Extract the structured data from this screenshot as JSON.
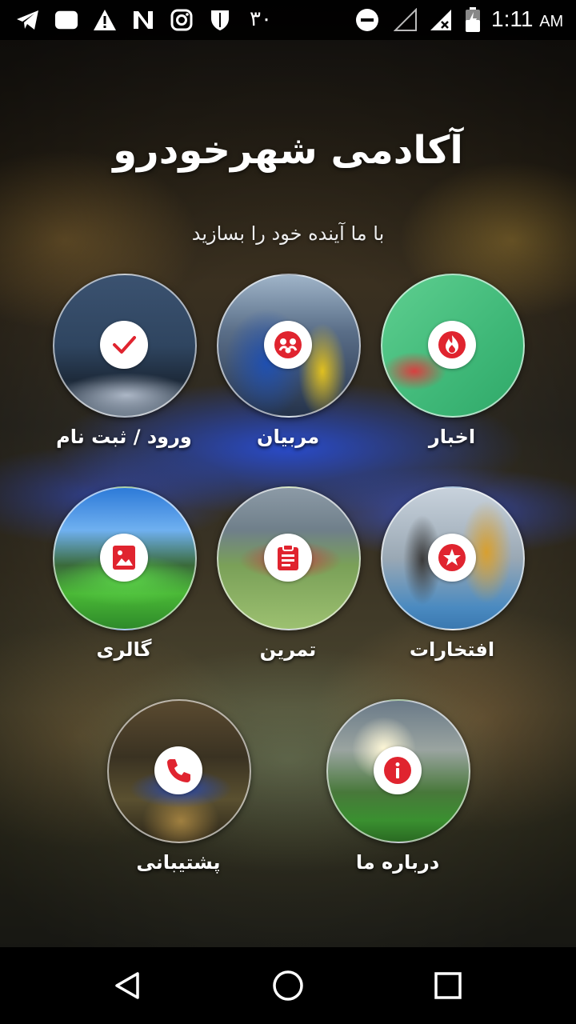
{
  "status_bar": {
    "digit": "۳۰",
    "time": "1:11",
    "ampm": "AM",
    "icons": [
      "telegram-icon",
      "notification-icon",
      "warning-icon",
      "n-app-icon",
      "instagram-icon",
      "shield-icon",
      "dnd-icon",
      "signal-empty-icon",
      "signal-x-icon",
      "battery-charging-icon"
    ]
  },
  "header": {
    "title": "آکادمی شهرخودرو",
    "subtitle": "با ما آینده خود را بسازید"
  },
  "menu": {
    "items": [
      {
        "label": "ورود / ثبت نام",
        "icon": "check-icon"
      },
      {
        "label": "مربیان",
        "icon": "coaches-icon"
      },
      {
        "label": "اخبار",
        "icon": "flame-icon"
      },
      {
        "label": "گالری",
        "icon": "gallery-icon"
      },
      {
        "label": "تمرین",
        "icon": "clipboard-icon"
      },
      {
        "label": "افتخارات",
        "icon": "star-icon"
      },
      {
        "label": "پشتیبانی",
        "icon": "phone-icon"
      },
      {
        "label": "درباره ما",
        "icon": "info-icon"
      }
    ]
  },
  "colors": {
    "accent": "#E0242F",
    "badge_bg": "#FFFFFF",
    "text": "#FFFFFF"
  },
  "nav": {
    "buttons": [
      "back-icon",
      "home-icon",
      "recents-icon"
    ]
  }
}
